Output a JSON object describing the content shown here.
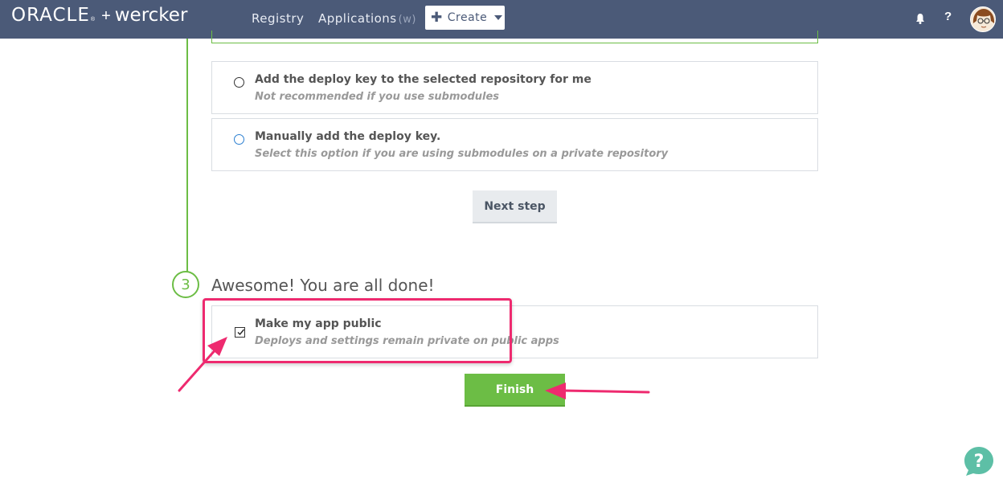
{
  "header": {
    "brand_oracle": "ORACLE",
    "brand_reg": "®",
    "brand_plus": "+",
    "brand_wercker": "wercker",
    "nav": [
      {
        "label": "Registry"
      },
      {
        "label": "Applications",
        "hint": "(w)"
      }
    ],
    "create_label": "Create",
    "create_icon": "plus-icon",
    "help_label": "?",
    "bell_icon": "bell-icon"
  },
  "options": [
    {
      "label": "Add the deploy key to the selected repository for me",
      "desc": "Not recommended if you use submodules",
      "selected": false
    },
    {
      "label": "Manually add the deploy key.",
      "desc": "Select this option if you are using submodules on a private repository",
      "selected": false
    }
  ],
  "next_step_label": "Next step",
  "step3": {
    "number": "3",
    "title": "Awesome! You are all done!",
    "public_label": "Make my app public",
    "public_desc": "Deploys and settings remain private on public apps",
    "public_checked": true,
    "finish_label": "Finish"
  },
  "colors": {
    "header_bg": "#4b5a78",
    "accent_green": "#6cbd45",
    "annotation_pink": "#ee2a6f",
    "help_teal": "#5dbfa6"
  },
  "floating_help_icon": "question-bubble-icon"
}
